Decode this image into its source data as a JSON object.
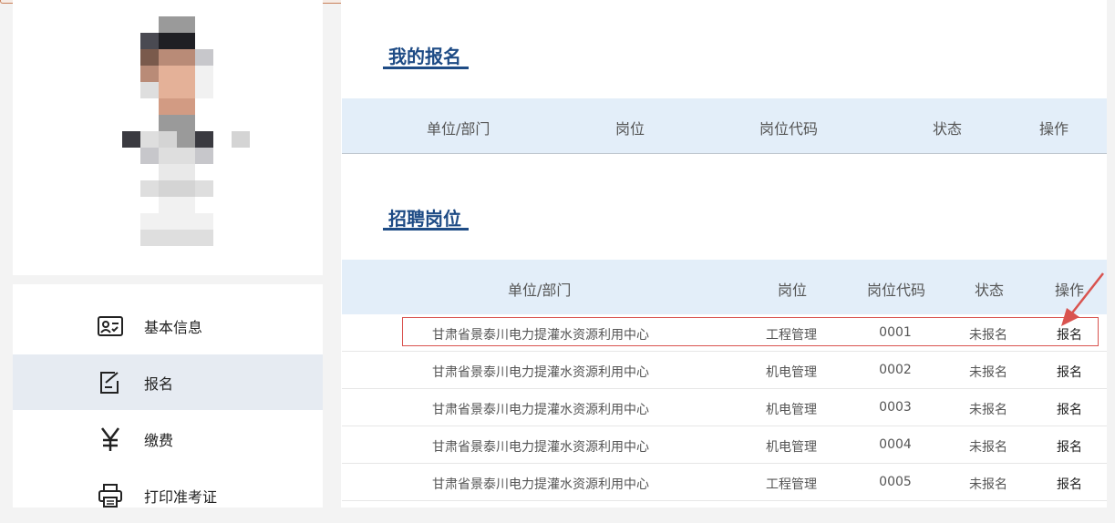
{
  "sidebar": {
    "items": [
      {
        "label": "基本信息",
        "icon": "id-card-icon",
        "active": false
      },
      {
        "label": "报名",
        "icon": "edit-form-icon",
        "active": true
      },
      {
        "label": "缴费",
        "icon": "yen-icon",
        "active": false
      },
      {
        "label": "打印准考证",
        "icon": "printer-icon",
        "active": false
      }
    ]
  },
  "my_registration": {
    "title": "我的报名",
    "headers": [
      "单位/部门",
      "岗位",
      "岗位代码",
      "状态",
      "操作"
    ]
  },
  "positions": {
    "title": "招聘岗位",
    "headers": [
      "单位/部门",
      "岗位",
      "岗位代码",
      "状态",
      "操作"
    ],
    "rows": [
      {
        "unit": "甘肃省景泰川电力提灌水资源利用中心",
        "post": "工程管理",
        "code": "0001",
        "status": "未报名",
        "action": "报名"
      },
      {
        "unit": "甘肃省景泰川电力提灌水资源利用中心",
        "post": "机电管理",
        "code": "0002",
        "status": "未报名",
        "action": "报名"
      },
      {
        "unit": "甘肃省景泰川电力提灌水资源利用中心",
        "post": "机电管理",
        "code": "0003",
        "status": "未报名",
        "action": "报名"
      },
      {
        "unit": "甘肃省景泰川电力提灌水资源利用中心",
        "post": "机电管理",
        "code": "0004",
        "status": "未报名",
        "action": "报名"
      },
      {
        "unit": "甘肃省景泰川电力提灌水资源利用中心",
        "post": "工程管理",
        "code": "0005",
        "status": "未报名",
        "action": "报名"
      }
    ]
  },
  "colors": {
    "accent": "#1e4b85",
    "header_bg": "#e3eef9",
    "highlight": "#d9534f",
    "active_menu": "#e6ebf2"
  }
}
